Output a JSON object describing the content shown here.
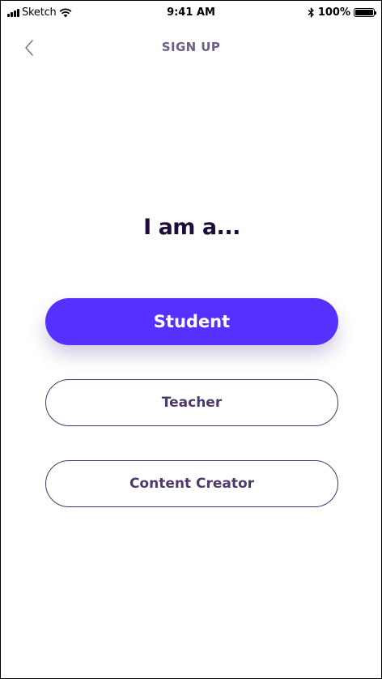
{
  "status_bar": {
    "carrier": "Sketch",
    "time": "9:41 AM",
    "battery": "100%",
    "battery_level": 1.0
  },
  "nav": {
    "title": "SIGN UP",
    "back_icon": "chevron-left-icon"
  },
  "heading": "I am a...",
  "roles": [
    {
      "label": "Student",
      "selected": true
    },
    {
      "label": "Teacher",
      "selected": false
    },
    {
      "label": "Content Creator",
      "selected": false
    }
  ],
  "colors": {
    "accent": "#5630ff",
    "heading": "#1d0b3a",
    "outline": "#4a3369",
    "nav_title": "#6e5f86"
  }
}
